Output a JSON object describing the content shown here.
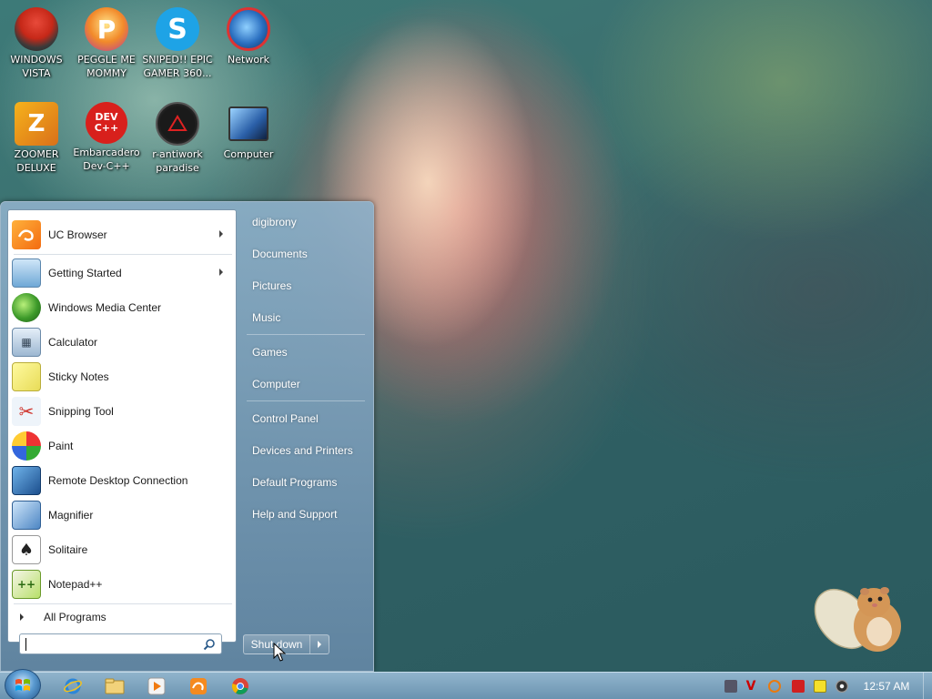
{
  "desktop": {
    "icons": [
      {
        "label": "WINDOWS VISTA",
        "icon": "vista-icon"
      },
      {
        "label": "PEGGLE ME MOMMY",
        "icon": "peggle-icon"
      },
      {
        "label": "SNIPED!! EPIC GAMER 360...",
        "icon": "skype-icon"
      },
      {
        "label": "Network",
        "icon": "network-icon"
      },
      {
        "label": "ZOOMER DELUXE",
        "icon": "zoomer-icon"
      },
      {
        "label": "Embarcadero Dev-C++",
        "icon": "devcpp-icon"
      },
      {
        "label": "r-antiwork paradise",
        "icon": "antiwork-icon"
      },
      {
        "label": "Computer",
        "icon": "computer-icon"
      }
    ],
    "devcpp_glyph": "DEV C++"
  },
  "start_menu": {
    "pinned": [
      {
        "label": "UC Browser",
        "icon": "uc-browser-icon",
        "has_submenu": true
      }
    ],
    "recent": [
      {
        "label": "Getting Started",
        "icon": "getting-started-icon",
        "has_submenu": true
      },
      {
        "label": "Windows Media Center",
        "icon": "media-center-icon",
        "has_submenu": false
      },
      {
        "label": "Calculator",
        "icon": "calculator-icon",
        "has_submenu": false
      },
      {
        "label": "Sticky Notes",
        "icon": "sticky-notes-icon",
        "has_submenu": false
      },
      {
        "label": "Snipping Tool",
        "icon": "snipping-tool-icon",
        "has_submenu": false
      },
      {
        "label": "Paint",
        "icon": "paint-icon",
        "has_submenu": false
      },
      {
        "label": "Remote Desktop Connection",
        "icon": "remote-desktop-icon",
        "has_submenu": false
      },
      {
        "label": "Magnifier",
        "icon": "magnifier-icon",
        "has_submenu": false
      },
      {
        "label": "Solitaire",
        "icon": "solitaire-icon",
        "has_submenu": false
      },
      {
        "label": "Notepad++",
        "icon": "notepadpp-icon",
        "has_submenu": false
      }
    ],
    "all_programs": "All Programs",
    "search": {
      "value": "",
      "placeholder": ""
    },
    "right_pane": {
      "group1": [
        "digibrony",
        "Documents",
        "Pictures",
        "Music"
      ],
      "group2": [
        "Games",
        "Computer"
      ],
      "group3": [
        "Control Panel",
        "Devices and Printers",
        "Default Programs",
        "Help and Support"
      ]
    },
    "shutdown_label": "Shut down"
  },
  "taskbar": {
    "pinned": [
      "internet-explorer-icon",
      "windows-explorer-icon",
      "media-player-icon",
      "uc-browser-icon",
      "chrome-icon"
    ],
    "tray": [
      "tray-app-icon",
      "tray-v-icon",
      "tray-search-icon",
      "tray-flag-icon",
      "tray-note-icon",
      "tray-volume-icon"
    ],
    "clock": "12:57 AM"
  },
  "colors": {
    "taskbar": "#8db4d2",
    "start_menu_right": "#7c9cb8",
    "left_pane": "#ffffff"
  }
}
